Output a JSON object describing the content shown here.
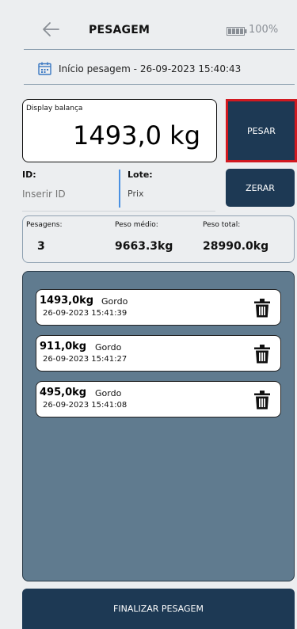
{
  "header": {
    "title": "PESAGEM",
    "battery_pct": "100%"
  },
  "start": {
    "text": "Início pesagem - 26-09-2023 15:40:43"
  },
  "display": {
    "label": "Display balança",
    "value": "1493,0 kg"
  },
  "buttons": {
    "pesar": "PESAR",
    "zerar": "ZERAR",
    "finalizar": "FINALIZAR PESAGEM"
  },
  "fields": {
    "id_label": "ID:",
    "id_placeholder": "Inserir ID",
    "lote_label": "Lote:",
    "lote_value": "Prix"
  },
  "stats": {
    "pesagens_label": "Pesagens:",
    "pesagens_value": "3",
    "medio_label": "Peso médio:",
    "medio_value": "9663.3kg",
    "total_label": "Peso total:",
    "total_value": "28990.0kg"
  },
  "weighings": [
    {
      "weight": "1493,0kg",
      "category": "Gordo",
      "datetime": "26-09-2023 15:41:39"
    },
    {
      "weight": "911,0kg",
      "category": "Gordo",
      "datetime": "26-09-2023 15:41:27"
    },
    {
      "weight": "495,0kg",
      "category": "Gordo",
      "datetime": "26-09-2023 15:41:08"
    }
  ],
  "colors": {
    "primary": "#1d3954",
    "highlight_border": "#d11920",
    "panel": "#607b8f",
    "accent_separator": "#4a90e2"
  },
  "icons": {
    "back": "arrow-left-icon",
    "battery": "battery-full-icon",
    "calendar": "calendar-icon",
    "delete": "trash-icon"
  }
}
